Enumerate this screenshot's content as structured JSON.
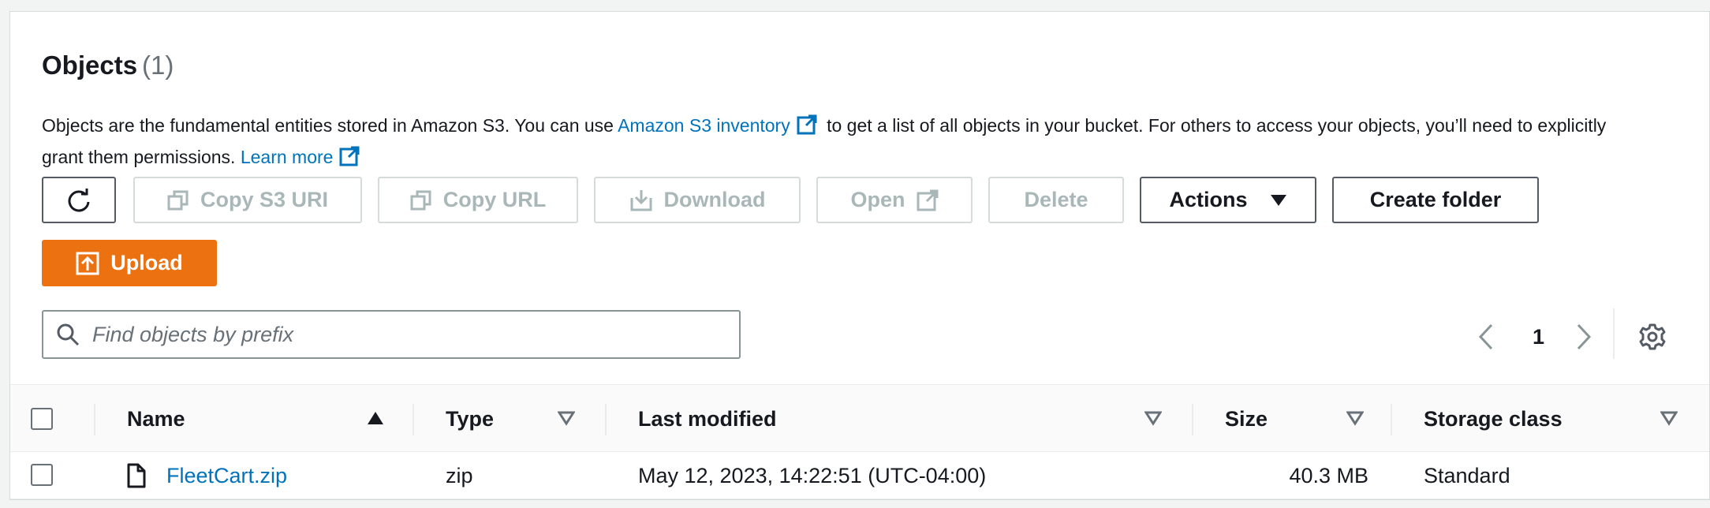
{
  "header": {
    "title": "Objects",
    "count": "(1)",
    "description_part1": "Objects are the fundamental entities stored in Amazon S3. You can use ",
    "inventory_link": "Amazon S3 inventory",
    "description_part2": " to get a list of all objects in your bucket. For others to access your objects, you’ll need to explicitly grant them permissions. ",
    "learn_more_link": "Learn more"
  },
  "toolbar": {
    "copy_s3_uri": "Copy S3 URI",
    "copy_url": "Copy URL",
    "download": "Download",
    "open": "Open",
    "delete": "Delete",
    "actions": "Actions",
    "create_folder": "Create folder",
    "upload": "Upload"
  },
  "search": {
    "placeholder": "Find objects by prefix",
    "value": ""
  },
  "pagination": {
    "current_page": "1"
  },
  "table": {
    "columns": {
      "name": "Name",
      "type": "Type",
      "last_modified": "Last modified",
      "size": "Size",
      "storage_class": "Storage class"
    },
    "rows": [
      {
        "name": "FleetCart.zip",
        "type": "zip",
        "last_modified": "May 12, 2023, 14:22:51 (UTC-04:00)",
        "size": "40.3 MB",
        "storage_class": "Standard"
      }
    ]
  },
  "colors": {
    "accent_orange": "#ec7211",
    "link_blue": "#0073bb",
    "disabled_gray": "#aab7b8"
  },
  "icons": [
    "refresh-icon",
    "copy-icon",
    "download-icon",
    "external-link-icon",
    "caret-down-icon",
    "upload-icon",
    "search-icon",
    "chevron-left-icon",
    "chevron-right-icon",
    "settings-icon",
    "sort-ascending-icon",
    "sort-icon",
    "file-icon"
  ]
}
